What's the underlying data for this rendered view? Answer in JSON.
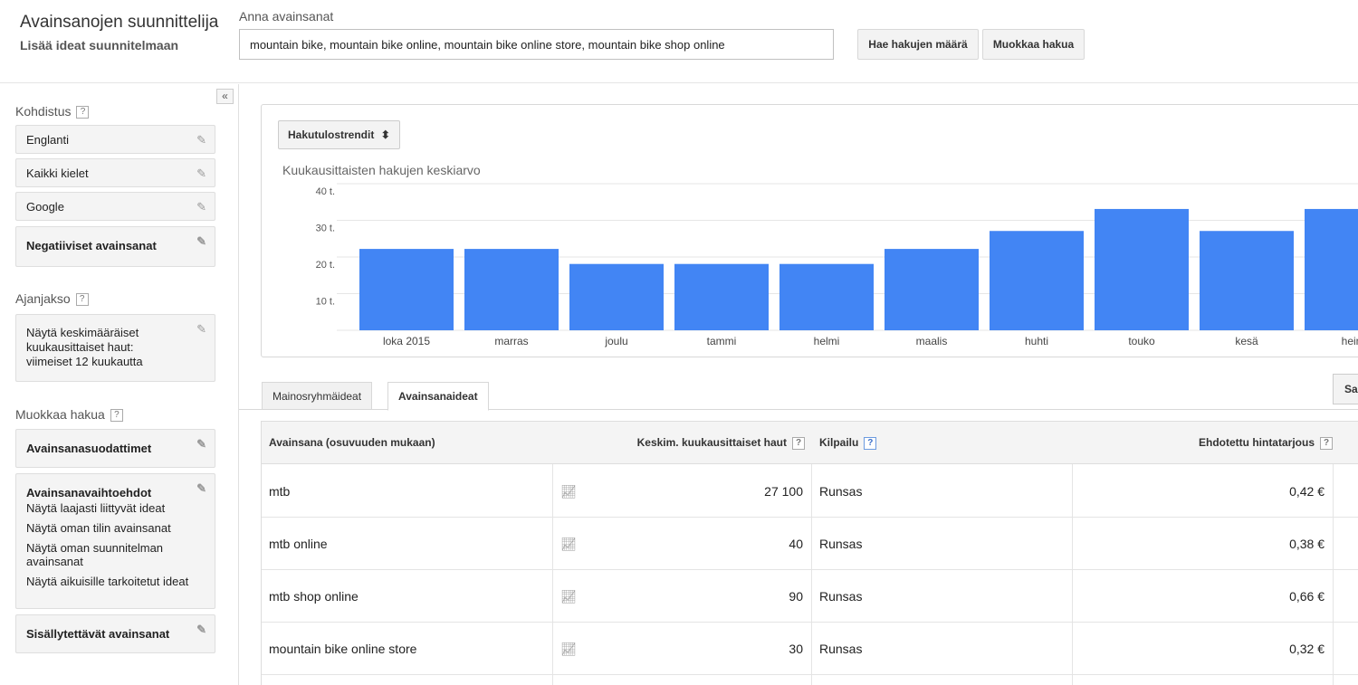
{
  "header": {
    "title": "Avainsanojen suunnittelija",
    "subtitle": "Lisää ideat suunnitelmaan",
    "keywords_label": "Anna avainsanat",
    "keywords_value": "mountain bike, mountain bike online, mountain bike online store, mountain bike shop online",
    "get_volume_button": "Hae hakujen määrä",
    "edit_search_button": "Muokkaa hakua"
  },
  "sidebar": {
    "collapse": "«",
    "targeting_title": "Kohdistus",
    "help": "?",
    "targeting": [
      "Englanti",
      "Kaikki kielet",
      "Google",
      "Negatiiviset avainsanat"
    ],
    "period_title": "Ajanjakso",
    "period_lines": [
      "Näytä keskimääräiset",
      "kuukausittaiset haut:",
      "viimeiset 12 kuukautta"
    ],
    "modify_title": "Muokkaa hakua",
    "keyword_filters": "Avainsanasuodattimet",
    "keyword_options_title": "Avainsanavaihtoehdot",
    "keyword_options": [
      "Näytä laajasti liittyvät ideat",
      "Näytä oman tilin avainsanat",
      "Näytä oman suunnitelman avainsanat",
      "Näytä aikuisille tarkoitetut ideat"
    ],
    "include_keywords": "Sisällytettävät avainsanat"
  },
  "main": {
    "trend_button": "Hakutulostrendit",
    "tabs": [
      "Mainosryhmäideat",
      "Avainsanaideat"
    ],
    "save_button": "Sa",
    "table": {
      "headers": [
        "Avainsana (osuvuuden mukaan)",
        "Keskim. kuukausittaiset haut",
        "Kilpailu",
        "Ehdotettu hintatarjous"
      ],
      "rows": [
        {
          "keyword": "mtb",
          "searches": "27 100",
          "competition": "Runsas",
          "bid": "0,42 €"
        },
        {
          "keyword": "mtb online",
          "searches": "40",
          "competition": "Runsas",
          "bid": "0,38 €"
        },
        {
          "keyword": "mtb shop online",
          "searches": "90",
          "competition": "Runsas",
          "bid": "0,66 €"
        },
        {
          "keyword": "mountain bike online store",
          "searches": "30",
          "competition": "Runsas",
          "bid": "0,32 €"
        }
      ]
    }
  },
  "chart_data": {
    "type": "bar",
    "title": "Kuukausittaisten hakujen keskiarvo",
    "categories": [
      "loka 2015",
      "marras",
      "joulu",
      "tammi",
      "helmi",
      "maalis",
      "huhti",
      "touko",
      "kesä",
      "hein"
    ],
    "values": [
      22200,
      22200,
      18100,
      18100,
      18100,
      22200,
      27100,
      33100,
      27100,
      33100
    ],
    "ytick_labels": [
      "10 t.",
      "20 t.",
      "30 t.",
      "40 t."
    ],
    "ytick_values": [
      10000,
      20000,
      30000,
      40000
    ],
    "ylim": [
      0,
      40000
    ],
    "color": "#4285f4",
    "grid": true
  }
}
